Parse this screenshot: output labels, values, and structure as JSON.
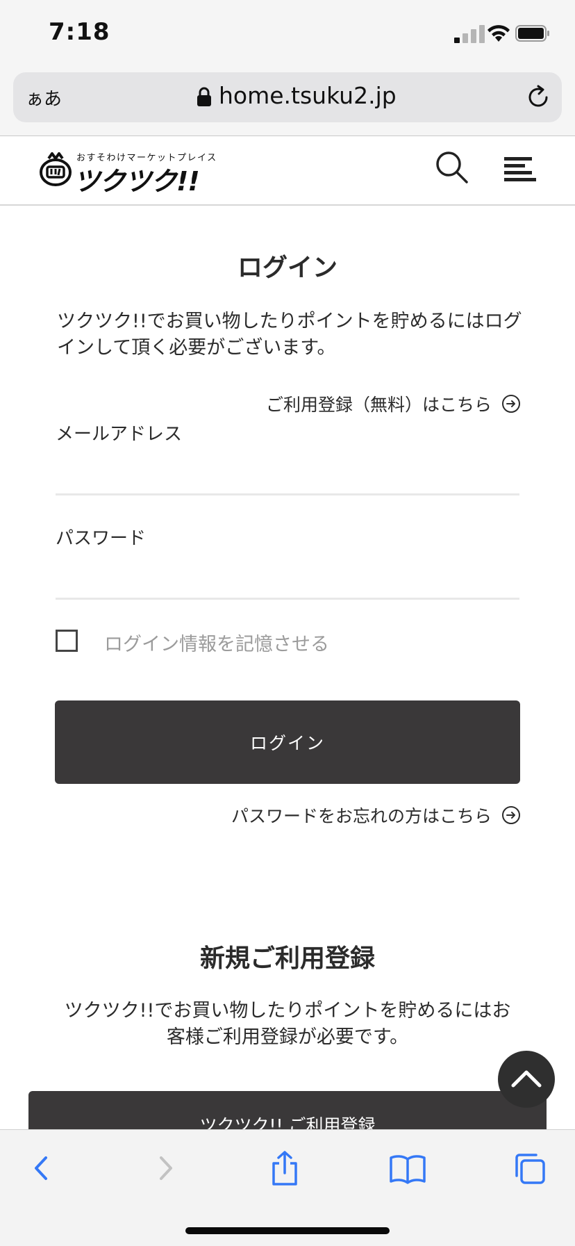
{
  "status_bar": {
    "time": "7:18"
  },
  "browser": {
    "text_size_label": "ぁあ",
    "url": "home.tsuku2.jp"
  },
  "site_header": {
    "logo_tagline": "おすそわけマーケットプレイス",
    "logo_name": "ツクツク!!"
  },
  "login": {
    "title": "ログイン",
    "description": "ツクツク!!でお買い物したりポイントを貯めるにはログインして頂く必要がございます。",
    "register_link": "ご利用登録（無料）はこちら",
    "email_label": "メールアドレス",
    "email_value": "",
    "password_label": "パスワード",
    "password_value": "",
    "remember_label": "ログイン情報を記憶させる",
    "remember_checked": false,
    "submit_label": "ログイン",
    "forgot_link": "パスワードをお忘れの方はこちら"
  },
  "register": {
    "title": "新規ご利用登録",
    "description": "ツクツク!!でお買い物したりポイントを貯めるにはお客様ご利用登録が必要です。",
    "button_label": "ツクツク!! ご利用登録"
  },
  "colors": {
    "button_bg": "#3a3839",
    "safari_blue": "#3478f6",
    "text": "#2b2b2b"
  },
  "icons": [
    "search-icon",
    "menu-icon",
    "arrow-circle-right-icon",
    "chevron-up-icon",
    "lock-icon",
    "reload-icon",
    "back-icon",
    "forward-icon",
    "share-icon",
    "bookmarks-icon",
    "tabs-icon"
  ]
}
